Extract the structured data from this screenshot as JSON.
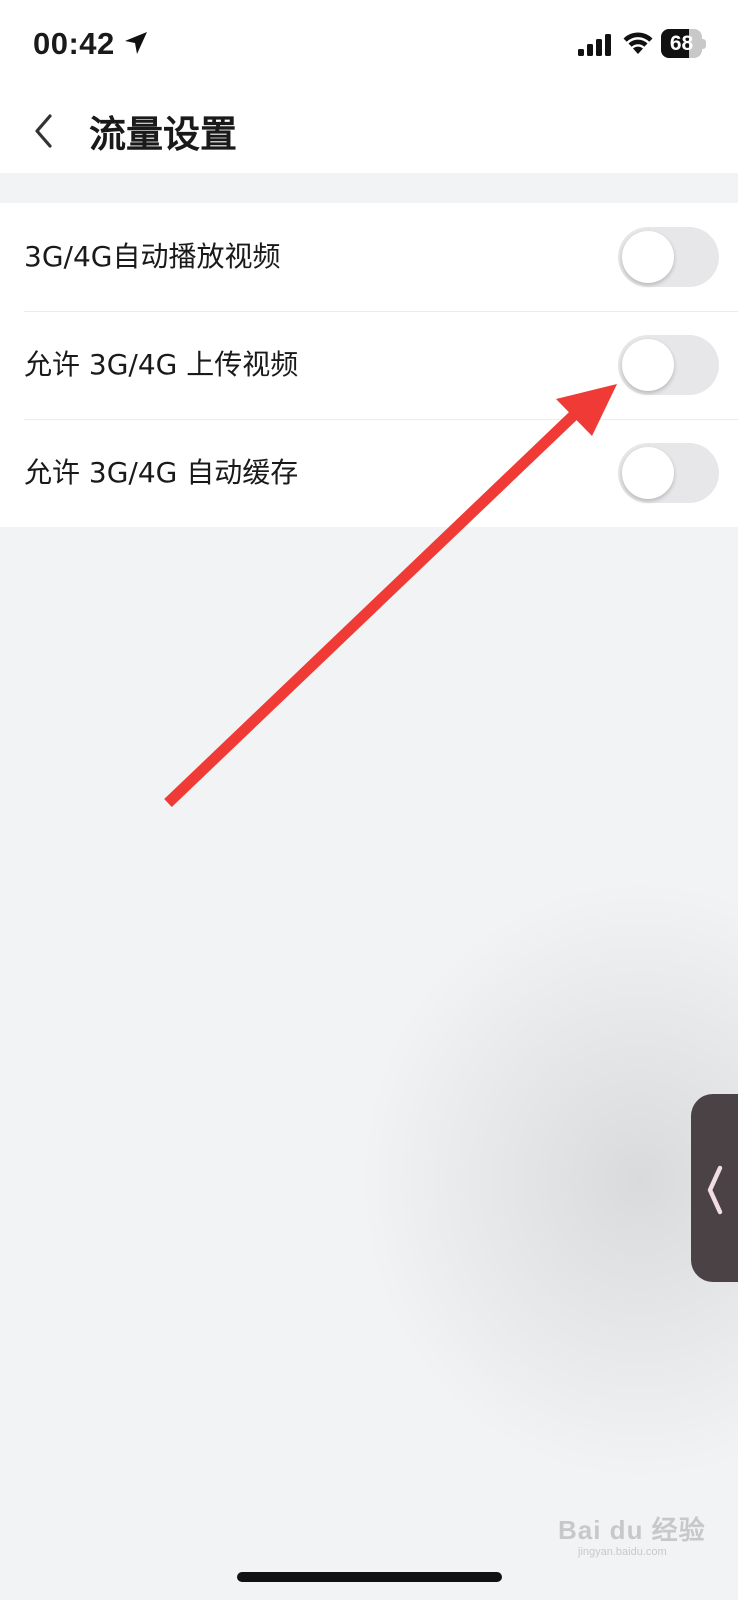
{
  "status_bar": {
    "time": "00:42",
    "battery_level": "68",
    "battery_fraction": 0.68,
    "icons": [
      "location-arrow-icon",
      "cellular-signal-icon",
      "wifi-icon",
      "battery-icon"
    ]
  },
  "header": {
    "title": "流量设置",
    "back_icon": "chevron-left-icon"
  },
  "settings": [
    {
      "label": "3G/4G自动播放视频",
      "enabled": false
    },
    {
      "label": "允许 3G/4G 上传视频",
      "enabled": false
    },
    {
      "label": "允许 3G/4G 自动缓存",
      "enabled": false
    }
  ],
  "annotation": {
    "type": "red-arrow",
    "color": "#f03a35",
    "points_to": "允许 3G/4G 上传视频 toggle"
  },
  "floating_handle": {
    "icon": "chevron-left-icon",
    "color": "#4a4244"
  },
  "watermark": {
    "text": "Bai du 经验",
    "subtext": "jingyan.baidu.com"
  },
  "colors": {
    "toggle_off": "#e7e7ea",
    "background": "#f2f3f5",
    "surface": "#ffffff"
  }
}
